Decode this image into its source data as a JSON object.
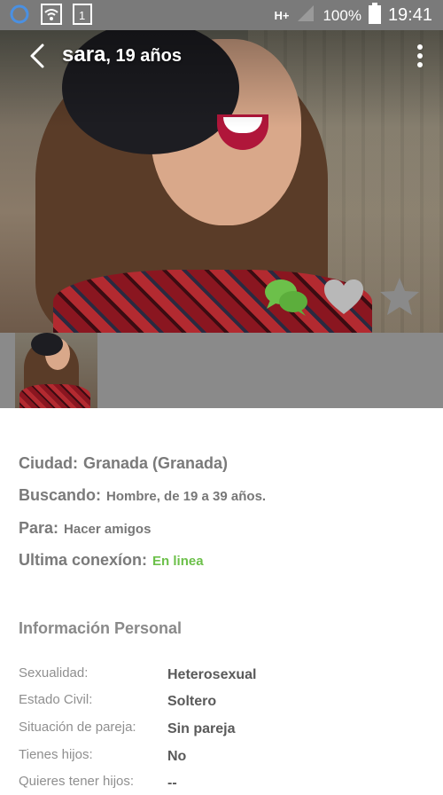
{
  "status_bar": {
    "network": "H+",
    "battery": "100%",
    "time": "19:41"
  },
  "profile": {
    "name": "sara",
    "age_text": ", 19 años"
  },
  "details": {
    "ciudad_label": "Ciudad:",
    "ciudad_value": "Granada (Granada)",
    "buscando_label": "Buscando:",
    "buscando_value": "Hombre, de 19 a 39 años.",
    "para_label": "Para:",
    "para_value": "Hacer amigos",
    "conexion_label": "Ultima conexíon:",
    "conexion_value": "En linea"
  },
  "personal": {
    "section_title": "Información Personal",
    "rows": [
      {
        "label": "Sexualidad:",
        "value": "Heterosexual"
      },
      {
        "label": "Estado Civil:",
        "value": "Soltero"
      },
      {
        "label": "Situación de pareja:",
        "value": "Sin pareja"
      },
      {
        "label": "Tienes hijos:",
        "value": "No"
      },
      {
        "label": "Quieres tener hijos:",
        "value": "--"
      }
    ]
  },
  "icons": {
    "chat": "chat-bubbles-icon",
    "heart": "heart-icon",
    "star": "star-icon"
  },
  "colors": {
    "accent_green": "#6cc04a",
    "status_bar": "#7a7a7a",
    "icon_gray": "#b8b8b8"
  }
}
